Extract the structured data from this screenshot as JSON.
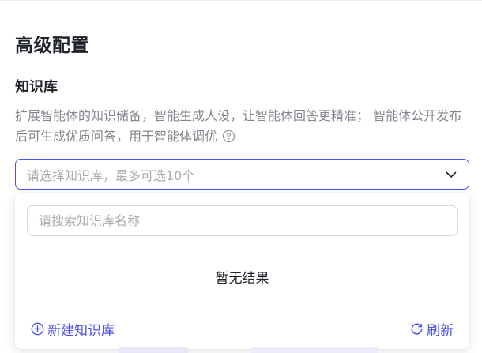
{
  "section": {
    "title": "高级配置"
  },
  "knowledge": {
    "title": "知识库",
    "description": "扩展智能体的知识储备，智能生成人设，让智能体回答更精准； 智能体公开发布后可生成优质问答，用于智能体调优",
    "select_placeholder": "请选择知识库，最多可选10个"
  },
  "dropdown": {
    "search_placeholder": "请搜索知识库名称",
    "empty_text": "暂无结果",
    "new_label": "新建知识库",
    "refresh_label": "刷新"
  },
  "colors": {
    "accent": "#4d53e8",
    "muted_text": "#83868d",
    "placeholder": "#a9abb0"
  },
  "icons": {
    "help": "help-circle-icon",
    "chevron": "chevron-down-icon",
    "add": "plus-circle-icon",
    "refresh": "refresh-icon"
  }
}
